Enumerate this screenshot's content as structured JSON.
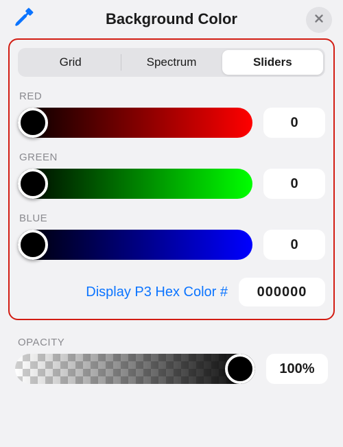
{
  "header": {
    "title": "Background Color"
  },
  "tabs": {
    "items": [
      "Grid",
      "Spectrum",
      "Sliders"
    ],
    "selected_index": 2
  },
  "channels": {
    "red": {
      "label": "RED",
      "value": "0"
    },
    "green": {
      "label": "GREEN",
      "value": "0"
    },
    "blue": {
      "label": "BLUE",
      "value": "0"
    }
  },
  "hex": {
    "label": "Display P3 Hex Color #",
    "value": "000000"
  },
  "opacity": {
    "label": "OPACITY",
    "value": "100%"
  }
}
